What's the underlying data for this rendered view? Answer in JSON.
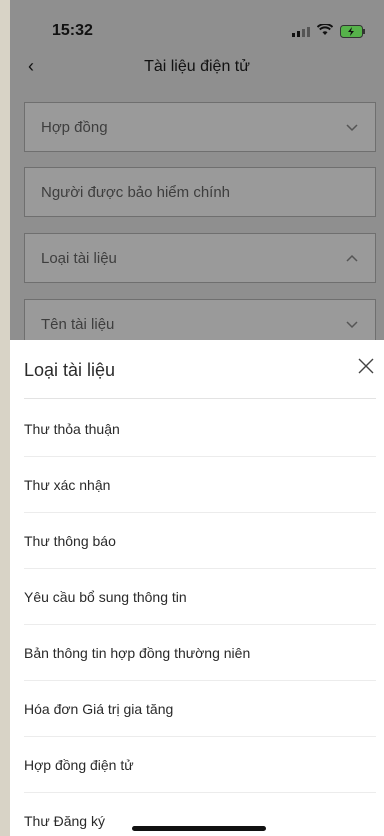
{
  "status": {
    "time": "15:32"
  },
  "nav": {
    "title": "Tài liệu điện tử"
  },
  "fields": {
    "contract": "Hợp đồng",
    "insured": "Người được bảo hiểm chính",
    "doc_type": "Loại tài liệu",
    "doc_name": "Tên tài liệu"
  },
  "sheet": {
    "title": "Loại tài liệu",
    "items": [
      "Thư thỏa thuận",
      "Thư xác nhận",
      "Thư thông báo",
      "Yêu cầu bổ sung thông tin",
      "Bản thông tin hợp đồng thường niên",
      "Hóa đơn Giá trị gia tăng",
      "Hợp đồng điện tử",
      "Thư Đăng ký"
    ]
  },
  "colors": {
    "overlay": "#8f8f8f",
    "sheet": "#ffffff"
  },
  "icons": [
    "back-chevron-icon",
    "chevron-down-icon",
    "chevron-up-icon",
    "close-icon",
    "signal-icon",
    "wifi-icon",
    "battery-icon"
  ]
}
